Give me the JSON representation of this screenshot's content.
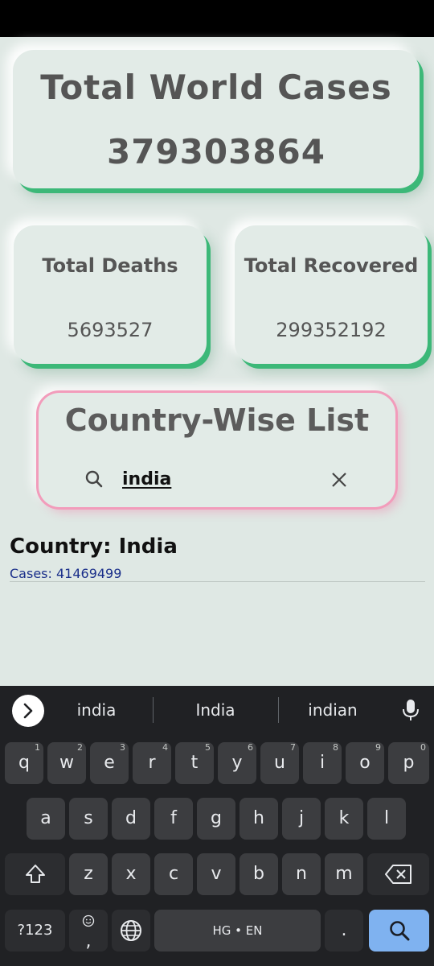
{
  "world": {
    "title": "Total World Cases",
    "value": "379303864"
  },
  "deaths": {
    "title": "Total Deaths",
    "value": "5693527"
  },
  "recovered": {
    "title": "Total Recovered",
    "value": "299352192"
  },
  "search": {
    "title": "Country-Wise List",
    "query": "india"
  },
  "result": {
    "country": "Country: India",
    "cases": "Cases:  41469499"
  },
  "keyboard": {
    "suggestions": [
      "india",
      "India",
      "indian"
    ],
    "row1": [
      {
        "k": "q",
        "h": "1"
      },
      {
        "k": "w",
        "h": "2"
      },
      {
        "k": "e",
        "h": "3"
      },
      {
        "k": "r",
        "h": "4"
      },
      {
        "k": "t",
        "h": "5"
      },
      {
        "k": "y",
        "h": "6"
      },
      {
        "k": "u",
        "h": "7"
      },
      {
        "k": "i",
        "h": "8"
      },
      {
        "k": "o",
        "h": "9"
      },
      {
        "k": "p",
        "h": "0"
      }
    ],
    "row2": [
      "a",
      "s",
      "d",
      "f",
      "g",
      "h",
      "j",
      "k",
      "l"
    ],
    "row3": [
      "z",
      "x",
      "c",
      "v",
      "b",
      "n",
      "m"
    ],
    "symbols_label": "?123",
    "comma_label": ",",
    "space_label": "HG • EN",
    "period_label": ".",
    "icons": {
      "shift": "shift-icon",
      "backspace": "backspace-icon",
      "globe": "globe-icon",
      "emoji": "emoji-icon",
      "search": "search-icon",
      "mic": "mic-icon",
      "expand": "chevron-right-icon"
    }
  },
  "colors": {
    "background": "#dfe8e4",
    "card_shadow_green": "#3cb878",
    "card_border_pink": "#f29cbb",
    "keyboard_bg": "#202124",
    "search_key": "#7fb2f0",
    "cases_text": "#1a2f8a"
  }
}
